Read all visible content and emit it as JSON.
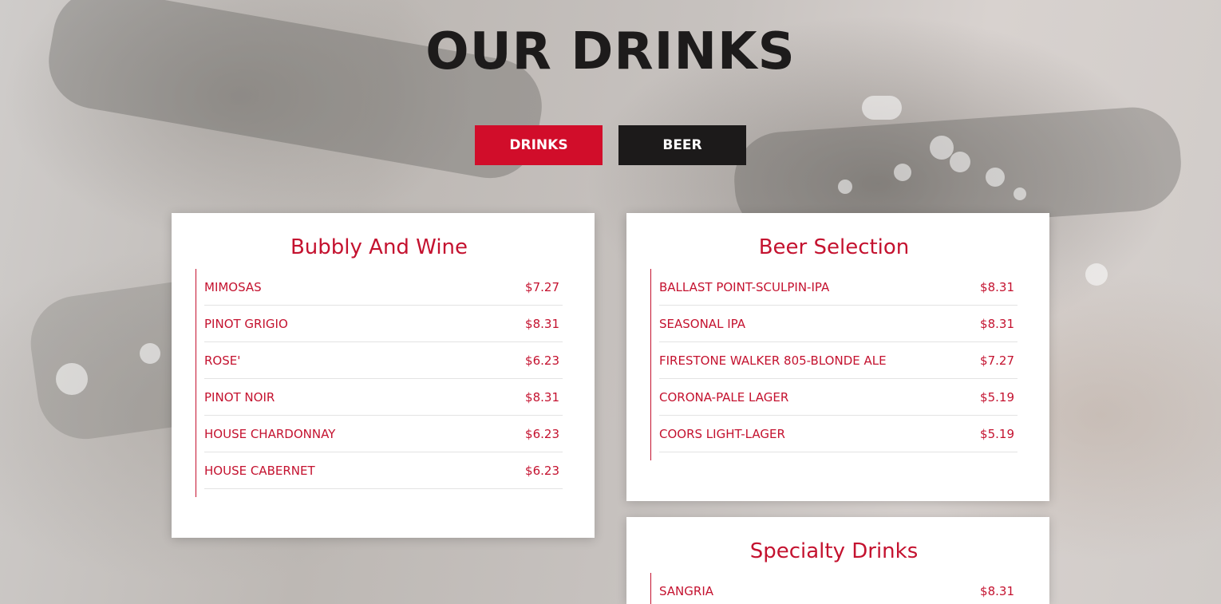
{
  "page": {
    "title": "OUR DRINKS"
  },
  "tabs": [
    {
      "label": "DRINKS",
      "active": true
    },
    {
      "label": "BEER",
      "active": false
    }
  ],
  "colors": {
    "accent": "#c4122f",
    "active_tab": "#d10d2a",
    "dark_tab": "#1c1a1a",
    "title": "#1d1b1b"
  },
  "sections": [
    {
      "title": "Bubbly And Wine",
      "items": [
        {
          "name": "MIMOSAS",
          "price": "$7.27"
        },
        {
          "name": "PINOT GRIGIO",
          "price": "$8.31"
        },
        {
          "name": "ROSE'",
          "price": "$6.23"
        },
        {
          "name": "PINOT NOIR",
          "price": "$8.31"
        },
        {
          "name": "HOUSE CHARDONNAY",
          "price": "$6.23"
        },
        {
          "name": "HOUSE CABERNET",
          "price": "$6.23"
        }
      ]
    },
    {
      "title": "Beer Selection",
      "items": [
        {
          "name": "BALLAST POINT-SCULPIN-IPA",
          "price": "$8.31"
        },
        {
          "name": "SEASONAL IPA",
          "price": "$8.31"
        },
        {
          "name": "FIRESTONE WALKER 805-BLONDE ALE",
          "price": "$7.27"
        },
        {
          "name": "CORONA-PALE LAGER",
          "price": "$5.19"
        },
        {
          "name": "COORS LIGHT-LAGER",
          "price": "$5.19"
        }
      ]
    },
    {
      "title": "Specialty Drinks",
      "items": [
        {
          "name": "SANGRIA",
          "price": "$8.31"
        }
      ]
    }
  ]
}
